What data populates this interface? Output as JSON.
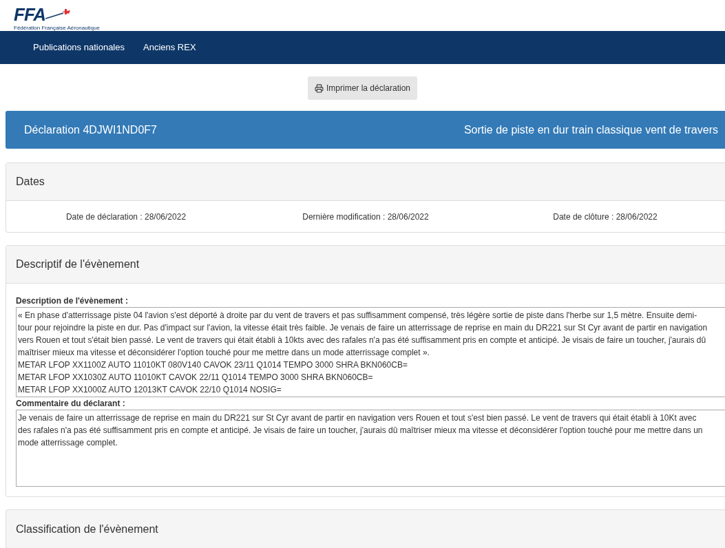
{
  "logo": {
    "text": "FFA",
    "subtitle": "Fédération Française Aéronautique"
  },
  "nav": [
    {
      "label": "Publications nationales"
    },
    {
      "label": "Anciens REX"
    }
  ],
  "print_button": "Imprimer la déclaration",
  "header": {
    "title": "Déclaration 4DJWI1ND0F7",
    "subject": "Sortie de piste en dur train classique vent de travers"
  },
  "dates": {
    "heading": "Dates",
    "items": [
      "Date de déclaration : 28/06/2022",
      "Dernière modification : 28/06/2022",
      "Date de clôture : 28/06/2022"
    ]
  },
  "event": {
    "heading": "Descriptif de l'évènement",
    "fields": [
      {
        "label": "Description de l'évènement :",
        "value": "« En phase d'atterrissage piste 04 l'avion s'est déporté à droite par du vent de travers et pas suffisamment compensé, très légère sortie de piste dans l'herbe sur 1,5 mètre. Ensuite demi-tour pour rejoindre la piste en dur. Pas d'impact sur l'avion, la vitesse était très faible. Je venais de faire un atterrissage de reprise en main du DR221 sur St Cyr avant de partir en navigation vers Rouen et tout s'était bien passé. Le vent de travers qui était établi à 10kts avec des rafales n'a pas été suffisamment pris en compte et anticipé. Je visais de faire un toucher, j'aurais dû maîtriser mieux ma vitesse et déconsidérer l'option touché pour me mettre dans un mode atterrissage complet ».\nMETAR LFOP XX1100Z AUTO 11010KT 080V140 CAVOK 23/11 Q1014 TEMPO 3000 SHRA BKN060CB=\nMETAR LFOP XX1030Z AUTO 11010KT CAVOK 22/11 Q1014 TEMPO 3000 SHRA BKN060CB=\nMETAR LFOP XX1000Z AUTO 12013KT CAVOK 22/10 Q1014 NOSIG="
      },
      {
        "label": "Commentaire du déclarant :",
        "value": "Je venais de faire un atterrissage de reprise en main du DR221 sur St Cyr avant de partir en navigation vers Rouen et tout s'est bien passé. Le vent de travers qui était établi à 10Kt avec des rafales n'a pas été suffisamment pris en compte et anticipé. Je visais de faire un toucher, j'aurais dû maîtriser mieux ma vitesse et déconsidérer l'option touché pour me mettre dans un mode atterrissage complet."
      }
    ]
  },
  "classification": {
    "heading": "Classification de l'évènement"
  }
}
